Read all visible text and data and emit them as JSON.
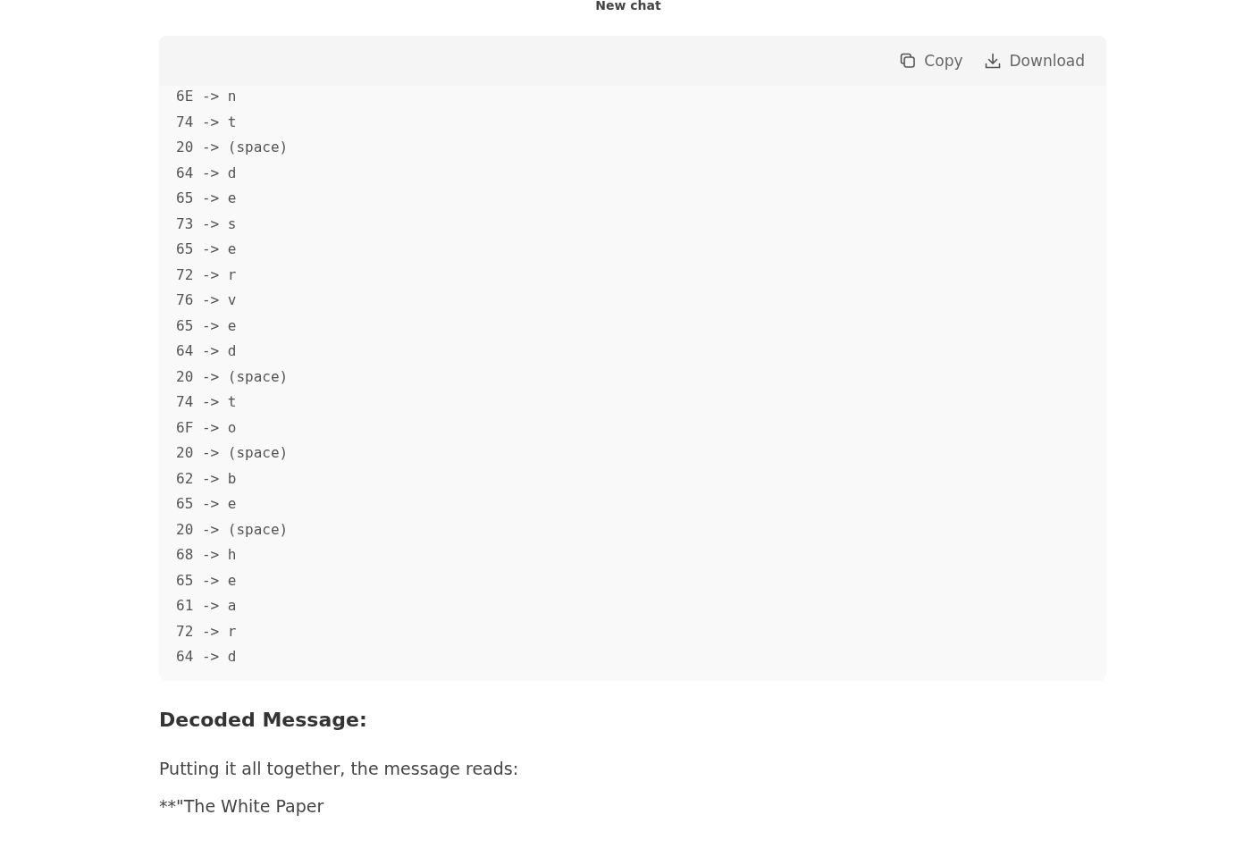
{
  "window": {
    "title": "New chat"
  },
  "code_block": {
    "actions": [
      {
        "kind": "copy",
        "label": "Copy"
      },
      {
        "kind": "download",
        "label": "Download"
      }
    ],
    "lines": [
      "6E -> n",
      "74 -> t",
      "20 -> (space)",
      "64 -> d",
      "65 -> e",
      "73 -> s",
      "65 -> e",
      "72 -> r",
      "76 -> v",
      "65 -> e",
      "64 -> d",
      "20 -> (space)",
      "74 -> t",
      "6F -> o",
      "20 -> (space)",
      "62 -> b",
      "65 -> e",
      "20 -> (space)",
      "68 -> h",
      "65 -> e",
      "61 -> a",
      "72 -> r",
      "64 -> d"
    ]
  },
  "heading": "Decoded Message:",
  "paragraphs": [
    "Putting it all together, the message reads:",
    "**\"The White Paper"
  ]
}
